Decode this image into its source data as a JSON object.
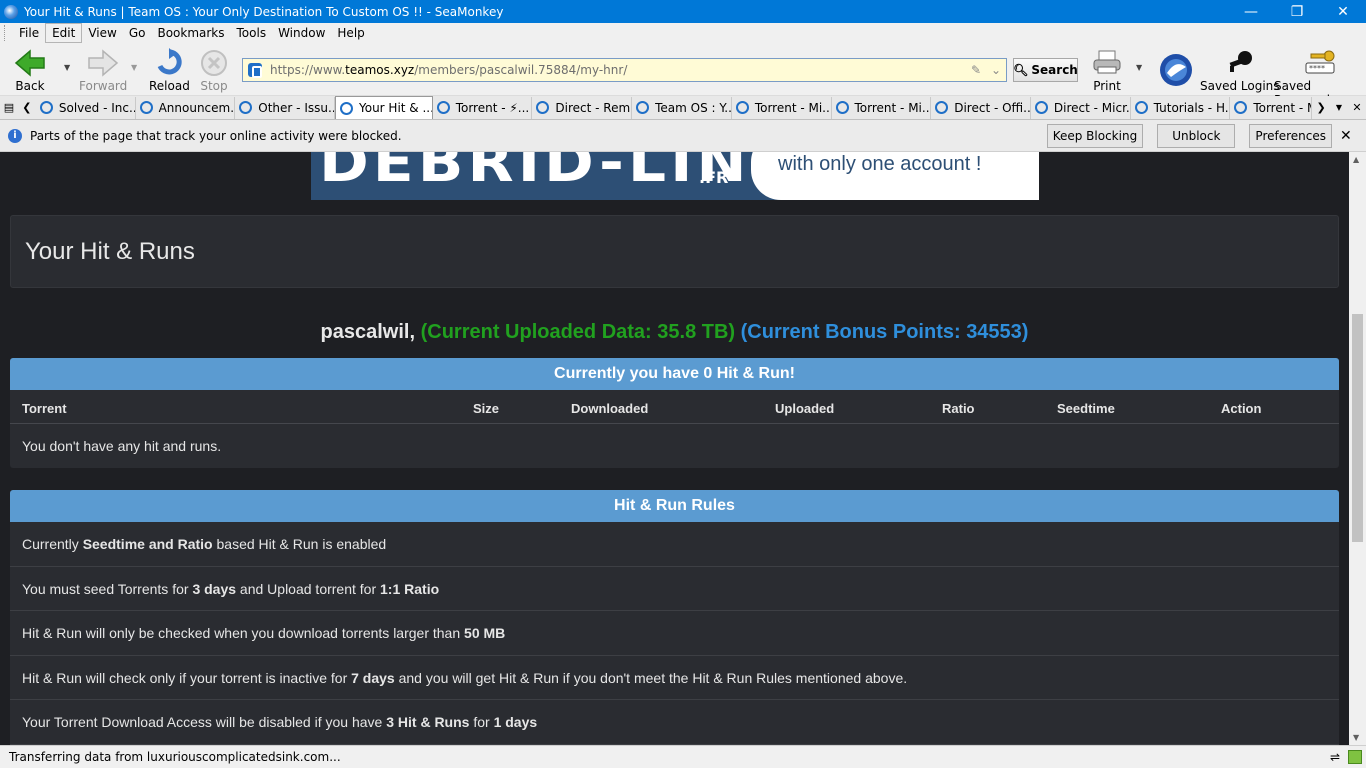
{
  "window": {
    "title": "Your Hit & Runs | Team OS : Your Only Destination To Custom OS !! - SeaMonkey",
    "minimize": "—",
    "restore": "❐",
    "close": "✕"
  },
  "menu": [
    "File",
    "Edit",
    "View",
    "Go",
    "Bookmarks",
    "Tools",
    "Window",
    "Help"
  ],
  "nav": {
    "back": "Back",
    "forward": "Forward",
    "reload": "Reload",
    "stop": "Stop",
    "print": "Print",
    "saved_logins": "Saved Logins",
    "saved_passwords": "Saved Passwords"
  },
  "url": {
    "scheme": "https://www.",
    "host": "teamos.xyz",
    "path": "/members/pascalwil.75884/my-hnr/"
  },
  "search_label": "Search",
  "tabs": [
    "Solved - Inc...",
    "Announcem...",
    "Other - Issu...",
    "Your Hit & ...",
    "Torrent - ⚡...",
    "Direct - Rem...",
    "Team OS : Y...",
    "Torrent - Mi...",
    "Torrent - Mi...",
    "Direct - Offi...",
    "Direct - Micr...",
    "Tutorials - H...",
    "Torrent - M"
  ],
  "notification": {
    "message": "Parts of the page that track your online activity were blocked.",
    "keep_blocking": "Keep Blocking",
    "unblock": "Unblock",
    "preferences": "Preferences"
  },
  "banner": {
    "logo": "DEBRID-LINK",
    "suffix": ".FR",
    "tagline": "with only one account !"
  },
  "page": {
    "title": "Your Hit & Runs",
    "username": "pascalwil,",
    "uploaded": "(Current Uploaded Data: 35.8 TB)",
    "bonus": "(Current Bonus Points: 34553)",
    "hnr_header": "Currently you have 0 Hit & Run!",
    "columns": [
      "Torrent",
      "Size",
      "Downloaded",
      "Uploaded",
      "Ratio",
      "Seedtime",
      "Action"
    ],
    "empty": "You don't have any hit and runs.",
    "rules_header": "Hit & Run Rules",
    "rules": [
      {
        "a": "Currently ",
        "b": "Seedtime and Ratio",
        "c": " based Hit & Run is enabled",
        "d": "",
        "e": ""
      },
      {
        "a": "You must seed Torrents for ",
        "b": "3 days",
        "c": " and Upload torrent for ",
        "d": "1:1 Ratio",
        "e": ""
      },
      {
        "a": "Hit & Run will only be checked when you download torrents larger than ",
        "b": "50 MB",
        "c": "",
        "d": "",
        "e": ""
      },
      {
        "a": "Hit & Run will check only if your torrent is inactive for ",
        "b": "7 days",
        "c": " and you will get Hit & Run if you don't meet the Hit & Run Rules mentioned above.",
        "d": "",
        "e": ""
      },
      {
        "a": "Your Torrent Download Access will be disabled if you have ",
        "b": "3 Hit & Runs",
        "c": " for ",
        "d": "1 days",
        "e": ""
      }
    ]
  },
  "status": "Transferring data from luxuriouscomplicatedsink.com..."
}
